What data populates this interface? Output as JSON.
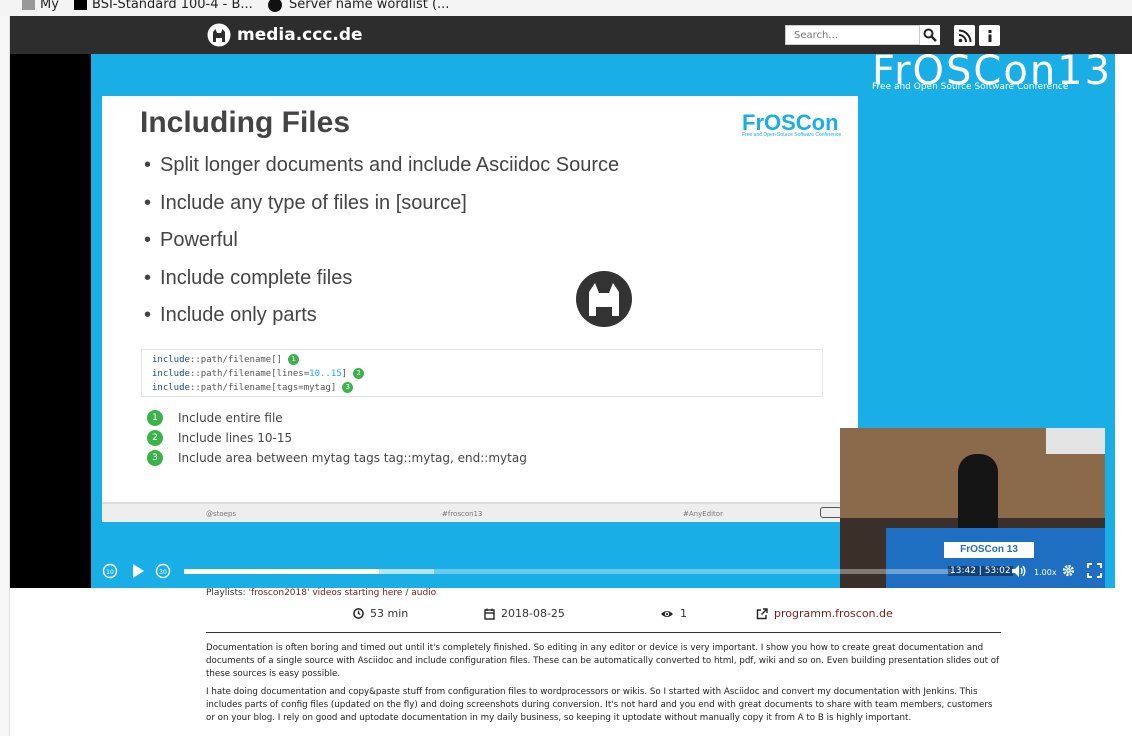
{
  "bookmarks": [
    {
      "label": "My"
    },
    {
      "label": "BSI-Standard 100-4 - B..."
    },
    {
      "label": "Server name wordlist (..."
    }
  ],
  "nav": {
    "site_name": "media.ccc.de",
    "search_placeholder": "Search...",
    "icons": [
      "search-icon",
      "rss-icon",
      "info-icon"
    ]
  },
  "player": {
    "brand": "FrOSCon13",
    "brand_sub": "Free and Open Source Software Conference",
    "slide": {
      "title": "Including Files",
      "logo": "FrOSCon",
      "logo_tag": "Free and Open Source Software Conference",
      "bullets": [
        "Split longer documents and include Asciidoc Source",
        "Include any type of files in [source]",
        "Powerful",
        "Include complete files",
        "Include only parts"
      ],
      "code": [
        {
          "kw": "include",
          "rest": "::path/filename[]",
          "callout": "1"
        },
        {
          "kw": "include",
          "rest": "::path/filename[lines=",
          "num": "10..15",
          "tail": "]",
          "callout": "2"
        },
        {
          "kw": "include",
          "rest": "::path/filename[tags=mytag]",
          "callout": "3"
        }
      ],
      "callouts": [
        {
          "num": "1",
          "text": "Include entire file"
        },
        {
          "num": "2",
          "text": "Include lines 10-15"
        },
        {
          "num": "3",
          "text": "Include area between mytag tags tag::mytag, end::mytag"
        }
      ],
      "footer": {
        "left": "@stoeps",
        "center": "#froscon13",
        "right": "#AnyEditor"
      }
    },
    "cam": {
      "banner": "FrOSCon 13"
    },
    "controls": {
      "rewind_label": "10",
      "forward_label": "30",
      "time": "13:42 | 53:02",
      "speed": "1.00x",
      "progress_played": 0.254,
      "progress_buffered": 0.325
    }
  },
  "playlists": {
    "label": "Playlists: ",
    "link1": "'froscon2018' videos starting here",
    "sep": " / ",
    "link2": "audio"
  },
  "meta": {
    "duration": "53 min",
    "date": "2018-08-25",
    "views": "1",
    "link": "programm.froscon.de"
  },
  "description": [
    "Documentation is often boring and timed out until it's completely finished. So editing in any editor or device is very important. I show you how to create great documentation and documents of a single source with Asciidoc and include configuration files. These can be automatically converted to html, pdf, wiki and so on. Even building presentation slides out of these sources is easy possible.",
    "I hate doing documentation and copy&paste stuff from configuration files to wordprocessors or wikis. So I started with Asciidoc and convert my documentation with Jenkins. This includes parts of config files (updated on the fly) and doing screenshots during conversion. It's not hard and you end with great documents to share with team members, customers or on your blog. I rely on good and uptodate documentation in my daily business, so keeping it uptodate without manually copy it from A to B is highly important."
  ]
}
